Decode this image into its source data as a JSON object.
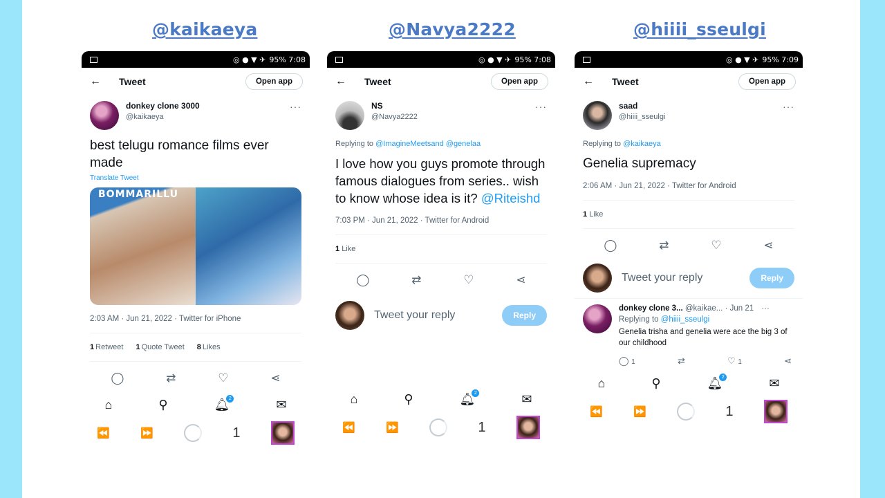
{
  "panels": [
    {
      "handle": "@kaikaeya",
      "status": {
        "battery": "95% 7:08"
      },
      "topbar": {
        "title": "Tweet",
        "open_app": "Open app"
      },
      "tweet": {
        "name": "donkey clone 3000",
        "handle": "@kaikaeya",
        "text": "best telugu romance films ever made",
        "translate": "Translate Tweet",
        "media_label": "BOMMARILLU",
        "meta": "2:03 AM · Jun 21, 2022 · Twitter for iPhone",
        "stats": [
          {
            "count": "1",
            "label": "Retweet"
          },
          {
            "count": "1",
            "label": "Quote Tweet"
          },
          {
            "count": "8",
            "label": "Likes"
          }
        ]
      },
      "tab_count": "1"
    },
    {
      "handle": "@Navya2222",
      "status": {
        "battery": "95% 7:08"
      },
      "topbar": {
        "title": "Tweet",
        "open_app": "Open app"
      },
      "tweet": {
        "name": "NS",
        "handle": "@Navya2222",
        "replying_prefix": "Replying to",
        "replying_to": "@ImagineMeetsand @genelaa",
        "text": "I love how you guys promote through famous dialogues from series.. wish to know whose idea is it? ",
        "mention": "@Riteishd",
        "meta": "7:03 PM · Jun 21, 2022 · Twitter for Android",
        "likes_count": "1",
        "likes_label": "Like"
      },
      "reply_placeholder": "Tweet your reply",
      "reply_button": "Reply",
      "tab_count": "1"
    },
    {
      "handle": "@hiiii_sseulgi",
      "status": {
        "battery": "95% 7:09"
      },
      "topbar": {
        "title": "Tweet",
        "open_app": "Open app"
      },
      "tweet": {
        "name": "saad",
        "handle": "@hiiii_sseulgi",
        "replying_prefix": "Replying to",
        "replying_to": "@kaikaeya",
        "text": "Genelia supremacy",
        "meta": "2:06 AM · Jun 21, 2022 · Twitter for Android",
        "likes_count": "1",
        "likes_label": "Like"
      },
      "reply_placeholder": "Tweet your reply",
      "reply_button": "Reply",
      "reply": {
        "name": "donkey clone 3...",
        "handle": "@kaikae...",
        "date": "· Jun 21",
        "replying_prefix": "Replying to",
        "replying_to": "@hiiii_sseulgi",
        "text": "Genelia trisha and genelia were ace the big 3 of our childhood",
        "reply_count": "1",
        "like_count": "1"
      },
      "tab_count": "1"
    }
  ],
  "notifications_badge": "2",
  "accent_color": "#1d9bf0",
  "handle_color": "#4a79c5",
  "border_color": "#9be6fb"
}
